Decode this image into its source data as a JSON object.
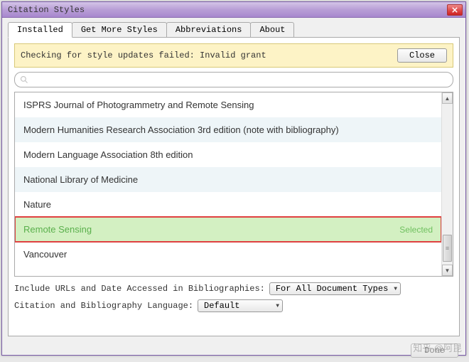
{
  "window": {
    "title": "Citation Styles"
  },
  "tabs": {
    "items": [
      {
        "label": "Installed"
      },
      {
        "label": "Get More Styles"
      },
      {
        "label": "Abbreviations"
      },
      {
        "label": "About"
      }
    ]
  },
  "notice": {
    "message": "Checking for style updates failed: Invalid grant",
    "close_label": "Close"
  },
  "search": {
    "placeholder": ""
  },
  "styles": {
    "items": [
      {
        "label": "ISPRS Journal of Photogrammetry and Remote Sensing"
      },
      {
        "label": "Modern Humanities Research Association 3rd edition (note with bibliography)"
      },
      {
        "label": "Modern Language Association 8th edition"
      },
      {
        "label": "National Library of Medicine"
      },
      {
        "label": "Nature"
      },
      {
        "label": "Remote Sensing"
      },
      {
        "label": "Vancouver"
      }
    ],
    "selected_badge": "Selected"
  },
  "options": {
    "include_urls_label": "Include URLs and Date Accessed in Bibliographies:",
    "include_urls_value": "For All Document Types",
    "language_label": "Citation and Bibliography Language:",
    "language_value": "Default"
  },
  "footer": {
    "done_label": "Done"
  },
  "watermark": "知乎 @阿昆"
}
